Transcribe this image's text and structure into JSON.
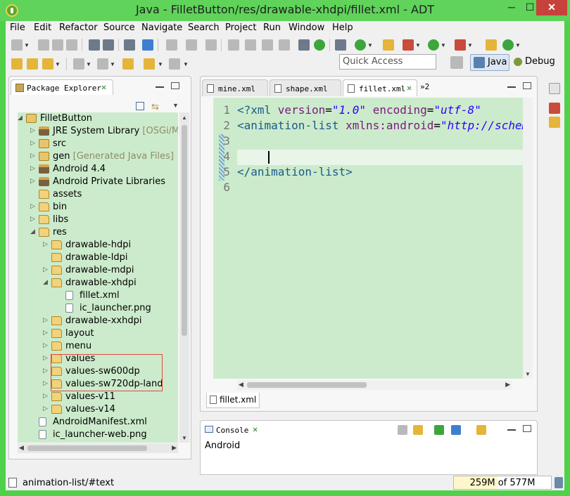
{
  "window": {
    "title": "Java - FilletButton/res/drawable-xhdpi/fillet.xml - ADT",
    "controls": {
      "minimize": "─",
      "maximize": "☐",
      "close": "✕"
    }
  },
  "menu": [
    "File",
    "Edit",
    "Refactor",
    "Source",
    "Navigate",
    "Search",
    "Project",
    "Run",
    "Window",
    "Help"
  ],
  "toolbar": {
    "quick_access_placeholder": "Quick Access",
    "perspectives": [
      {
        "label": "Java",
        "active": true,
        "icon": "java-perspective-icon"
      },
      {
        "label": "Debug",
        "active": false,
        "icon": "bug-icon"
      }
    ]
  },
  "package_explorer": {
    "tab_label": "Package Explorer",
    "tree": [
      {
        "label": "FilletButton",
        "decoration": "",
        "icon": "project",
        "depth": 0,
        "expanded": true
      },
      {
        "label": "JRE System Library",
        "decoration": "[OSGi/Mi",
        "icon": "library",
        "depth": 1,
        "expanded": false
      },
      {
        "label": "src",
        "decoration": "",
        "icon": "srcfolder",
        "depth": 1,
        "expanded": false
      },
      {
        "label": "gen",
        "decoration": "[Generated Java Files]",
        "icon": "srcfolder",
        "depth": 1,
        "expanded": false
      },
      {
        "label": "Android 4.4",
        "decoration": "",
        "icon": "library",
        "depth": 1,
        "expanded": false
      },
      {
        "label": "Android Private Libraries",
        "decoration": "",
        "icon": "library",
        "depth": 1,
        "expanded": false
      },
      {
        "label": "assets",
        "decoration": "",
        "icon": "folder",
        "depth": 1,
        "expanded": null
      },
      {
        "label": "bin",
        "decoration": "",
        "icon": "folder",
        "depth": 1,
        "expanded": false
      },
      {
        "label": "libs",
        "decoration": "",
        "icon": "folder",
        "depth": 1,
        "expanded": false
      },
      {
        "label": "res",
        "decoration": "",
        "icon": "folder",
        "depth": 1,
        "expanded": true
      },
      {
        "label": "drawable-hdpi",
        "decoration": "",
        "icon": "folder",
        "depth": 2,
        "expanded": false
      },
      {
        "label": "drawable-ldpi",
        "decoration": "",
        "icon": "folder",
        "depth": 2,
        "expanded": null
      },
      {
        "label": "drawable-mdpi",
        "decoration": "",
        "icon": "folder",
        "depth": 2,
        "expanded": false
      },
      {
        "label": "drawable-xhdpi",
        "decoration": "",
        "icon": "folder",
        "depth": 2,
        "expanded": true
      },
      {
        "label": "fillet.xml",
        "decoration": "",
        "icon": "file",
        "depth": 3,
        "expanded": null
      },
      {
        "label": "ic_launcher.png",
        "decoration": "",
        "icon": "imgfile",
        "depth": 3,
        "expanded": null
      },
      {
        "label": "drawable-xxhdpi",
        "decoration": "",
        "icon": "folder",
        "depth": 2,
        "expanded": false
      },
      {
        "label": "layout",
        "decoration": "",
        "icon": "folder",
        "depth": 2,
        "expanded": false
      },
      {
        "label": "menu",
        "decoration": "",
        "icon": "folder",
        "depth": 2,
        "expanded": false
      },
      {
        "label": "values",
        "decoration": "",
        "icon": "folder",
        "depth": 2,
        "expanded": false
      },
      {
        "label": "values-sw600dp",
        "decoration": "",
        "icon": "folder",
        "depth": 2,
        "expanded": false
      },
      {
        "label": "values-sw720dp-land",
        "decoration": "",
        "icon": "folder",
        "depth": 2,
        "expanded": false
      },
      {
        "label": "values-v11",
        "decoration": "",
        "icon": "folder",
        "depth": 2,
        "expanded": false
      },
      {
        "label": "values-v14",
        "decoration": "",
        "icon": "folder",
        "depth": 2,
        "expanded": false
      },
      {
        "label": "AndroidManifest.xml",
        "decoration": "",
        "icon": "file",
        "depth": 1,
        "expanded": null
      },
      {
        "label": "ic_launcher-web.png",
        "decoration": "",
        "icon": "imgfile",
        "depth": 1,
        "expanded": null
      }
    ]
  },
  "editor": {
    "tabs": [
      {
        "label": "mine.xml",
        "active": false
      },
      {
        "label": "shape.xml",
        "active": false
      },
      {
        "label": "fillet.xml",
        "active": true
      }
    ],
    "overflow_label": "»2",
    "line_numbers": [
      "1",
      "2",
      "3",
      "4",
      "5",
      "6"
    ],
    "lines": [
      [
        [
          "pi",
          "<?xml "
        ],
        [
          "attr",
          "version"
        ],
        [
          "plain",
          "="
        ],
        [
          "str",
          "\"1.0\""
        ],
        [
          "plain",
          " "
        ],
        [
          "attr",
          "encoding"
        ],
        [
          "plain",
          "="
        ],
        [
          "str",
          "\"utf-8\""
        ]
      ],
      [
        [
          "tag",
          "<animation-list "
        ],
        [
          "attr",
          "xmlns:android"
        ],
        [
          "plain",
          "="
        ],
        [
          "str",
          "\"http://schemas.android.com/apk/res/android\""
        ]
      ],
      [],
      [],
      [
        [
          "tag",
          "</animation-list>"
        ]
      ],
      []
    ],
    "bottom_tab": "fillet.xml"
  },
  "console": {
    "tab_label": "Console",
    "content": "Android"
  },
  "status": {
    "text": "animation-list/#text",
    "heap_used": "259M",
    "heap_total": "577M",
    "heap_label": "259M of 577M",
    "heap_fraction": 0.449
  },
  "colors": {
    "window_frame": "#4fd14a",
    "close_button": "#c7423b",
    "view_background": "#ccebcc",
    "highlight_box": "#e0483c"
  }
}
